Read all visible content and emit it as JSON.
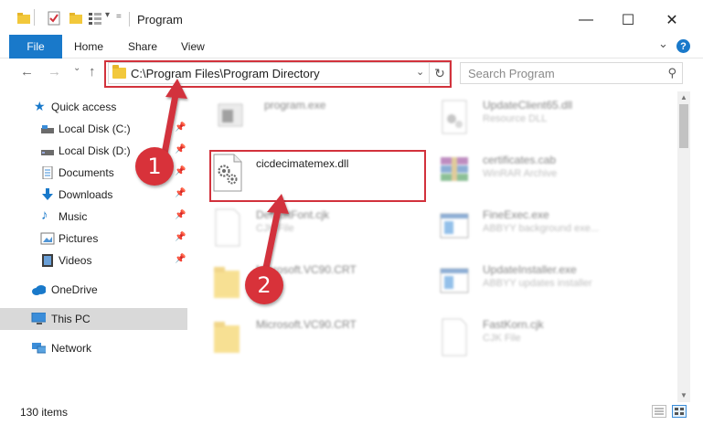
{
  "window": {
    "title": "Program",
    "minimize_glyph": "—",
    "maximize_glyph": "☐",
    "close_glyph": "✕"
  },
  "ribbon": {
    "file_tab": "File",
    "tabs": [
      "Home",
      "Share",
      "View"
    ],
    "collapse_glyph": "⌄",
    "help_glyph": "?"
  },
  "navigation": {
    "back_glyph": "←",
    "forward_glyph": "→",
    "recent_glyph": "⌄",
    "up_glyph": "↑",
    "address": "C:\\Program Files\\Program Directory",
    "address_dropdown_glyph": "⌄",
    "refresh_glyph": "↻",
    "search_placeholder": "Search Program",
    "search_glyph": "⚲"
  },
  "sidebar": {
    "quick_access": "Quick access",
    "items": [
      {
        "label": "Local Disk (C:)",
        "pinned": true
      },
      {
        "label": "Local Disk (D:)",
        "pinned": true
      },
      {
        "label": "Documents",
        "pinned": true
      },
      {
        "label": "Downloads",
        "pinned": true
      },
      {
        "label": "Music",
        "pinned": true
      },
      {
        "label": "Pictures",
        "pinned": true
      },
      {
        "label": "Videos",
        "pinned": true
      }
    ],
    "onedrive": "OneDrive",
    "this_pc": "This PC",
    "network": "Network",
    "pin_glyph": "📌"
  },
  "files": [
    {
      "name": "program.exe",
      "desc": "",
      "icon": "exe-icon"
    },
    {
      "name": "UpdateClient65.dll",
      "desc": "Resource DLL",
      "icon": "dll-icon"
    },
    {
      "name": "cicdecimatemex.dll",
      "desc": "",
      "icon": "gear-dll-icon"
    },
    {
      "name": "certificates.cab",
      "desc": "WinRAR Archive",
      "icon": "rar-icon"
    },
    {
      "name": "DefaultFont.cjk",
      "desc": "CJK File",
      "icon": "blank-file-icon"
    },
    {
      "name": "FineExec.exe",
      "desc": "ABBYY background exe...",
      "icon": "window-icon"
    },
    {
      "name": "Microsoft.VC90.CRT",
      "desc": "",
      "icon": "folder-icon"
    },
    {
      "name": "UpdateInstaller.exe",
      "desc": "ABBYY updates installer",
      "icon": "window-icon"
    },
    {
      "name": "Microsoft.VC90.CRT",
      "desc": "",
      "icon": "folder-icon"
    },
    {
      "name": "FastKorn.cjk",
      "desc": "CJK File",
      "icon": "blank-file-icon"
    }
  ],
  "status": {
    "item_count": "130 items"
  },
  "annotations": {
    "step1": "1",
    "step2": "2",
    "color": "#d2323c"
  },
  "colors": {
    "accent": "#1979ca",
    "selection": "#d9d9d9",
    "highlight": "#d2323c"
  }
}
